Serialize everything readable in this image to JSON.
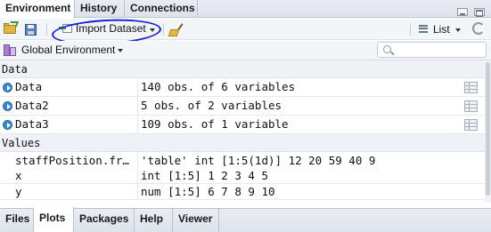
{
  "top_tabs": [
    "Environment",
    "History",
    "Connections"
  ],
  "toolbar": {
    "import_label": "Import Dataset",
    "list_label": "List"
  },
  "env": {
    "scope_label": "Global Environment",
    "search_placeholder": ""
  },
  "sections": {
    "data_header": "Data",
    "values_header": "Values"
  },
  "data_rows": [
    {
      "name": "Data",
      "value": "140 obs. of 6 variables"
    },
    {
      "name": "Data2",
      "value": "5 obs. of 2 variables"
    },
    {
      "name": "Data3",
      "value": "109 obs. of 1 variable"
    }
  ],
  "value_rows": [
    {
      "name": "staffPosition.fr…",
      "value": "'table' int [1:5(1d)] 12 20 59 40 9"
    },
    {
      "name": "x",
      "value": "int [1:5] 1 2 3 4 5"
    },
    {
      "name": "y",
      "value": "num [1:5] 6 7 8 9 10"
    }
  ],
  "bottom_tabs": [
    "Files",
    "Plots",
    "Packages",
    "Help",
    "Viewer"
  ],
  "colors": {
    "annotation_circle": "#1d1fd0",
    "accent": "#3b87c9"
  }
}
